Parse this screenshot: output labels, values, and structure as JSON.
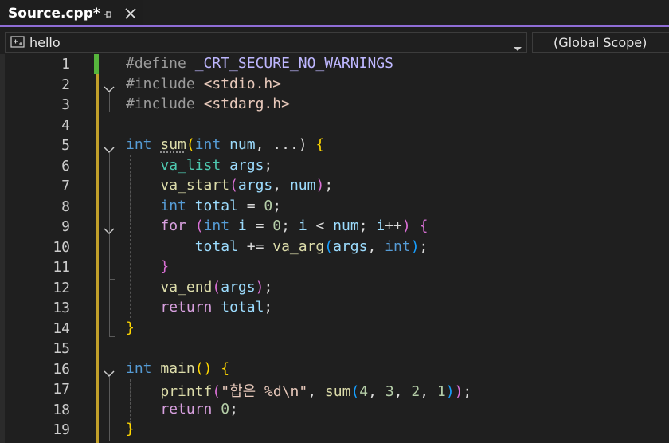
{
  "tab": {
    "title": "Source.cpp*",
    "pin_icon": "pin-icon",
    "close_icon": "close-icon"
  },
  "nav": {
    "left_scope": "hello",
    "right_scope": "(Global Scope)",
    "left_icon": "project-icon",
    "arrow_icon": "dropdown-arrow-icon"
  },
  "colors": {
    "accent": "#8f6dd6",
    "modified": "#56b53c",
    "saved": "#c2a02a",
    "background": "#1f1f1f"
  },
  "lines": [
    {
      "n": "1",
      "fold": false,
      "tokens": [
        [
          "pp",
          "#define"
        ],
        [
          "cm",
          " "
        ],
        [
          "macro",
          "_CRT_SECURE_NO_WARNINGS"
        ]
      ]
    },
    {
      "n": "2",
      "fold": true,
      "tokens": [
        [
          "pp",
          "#include"
        ],
        [
          "cm",
          " "
        ],
        [
          "str",
          "<stdio.h>"
        ]
      ]
    },
    {
      "n": "3",
      "fold": false,
      "tokens": [
        [
          "pp",
          "#include"
        ],
        [
          "cm",
          " "
        ],
        [
          "str",
          "<stdarg.h>"
        ]
      ]
    },
    {
      "n": "4",
      "fold": false,
      "tokens": []
    },
    {
      "n": "5",
      "fold": true,
      "tokens": [
        [
          "kw",
          "int"
        ],
        [
          "cm",
          " "
        ],
        [
          "fnsum",
          "sum"
        ],
        [
          "p1",
          "("
        ],
        [
          "kw",
          "int"
        ],
        [
          "cm",
          " "
        ],
        [
          "var",
          "num"
        ],
        [
          "cm",
          ", ...) "
        ],
        [
          "p1",
          "{"
        ]
      ]
    },
    {
      "n": "6",
      "fold": false,
      "tokens": [
        [
          "cm",
          "    "
        ],
        [
          "ty",
          "va_list"
        ],
        [
          "cm",
          " "
        ],
        [
          "var",
          "args"
        ],
        [
          "cm",
          ";"
        ]
      ]
    },
    {
      "n": "7",
      "fold": false,
      "tokens": [
        [
          "cm",
          "    "
        ],
        [
          "fn",
          "va_start"
        ],
        [
          "p2",
          "("
        ],
        [
          "var",
          "args"
        ],
        [
          "cm",
          ", "
        ],
        [
          "var",
          "num"
        ],
        [
          "p2",
          ")"
        ],
        [
          "cm",
          ";"
        ]
      ]
    },
    {
      "n": "8",
      "fold": false,
      "tokens": [
        [
          "cm",
          "    "
        ],
        [
          "kw",
          "int"
        ],
        [
          "cm",
          " "
        ],
        [
          "var",
          "total"
        ],
        [
          "cm",
          " = "
        ],
        [
          "num",
          "0"
        ],
        [
          "cm",
          ";"
        ]
      ]
    },
    {
      "n": "9",
      "fold": true,
      "tokens": [
        [
          "cm",
          "    "
        ],
        [
          "ctl",
          "for"
        ],
        [
          "cm",
          " "
        ],
        [
          "p2",
          "("
        ],
        [
          "kw",
          "int"
        ],
        [
          "cm",
          " "
        ],
        [
          "var",
          "i"
        ],
        [
          "cm",
          " = "
        ],
        [
          "num",
          "0"
        ],
        [
          "cm",
          "; "
        ],
        [
          "var",
          "i"
        ],
        [
          "cm",
          " < "
        ],
        [
          "var",
          "num"
        ],
        [
          "cm",
          "; "
        ],
        [
          "var",
          "i"
        ],
        [
          "cm",
          "++"
        ],
        [
          "p2",
          ")"
        ],
        [
          "cm",
          " "
        ],
        [
          "p2",
          "{"
        ]
      ]
    },
    {
      "n": "10",
      "fold": false,
      "tokens": [
        [
          "cm",
          "        "
        ],
        [
          "var",
          "total"
        ],
        [
          "cm",
          " += "
        ],
        [
          "fn",
          "va_arg"
        ],
        [
          "p3",
          "("
        ],
        [
          "var",
          "args"
        ],
        [
          "cm",
          ", "
        ],
        [
          "kw",
          "int"
        ],
        [
          "p3",
          ")"
        ],
        [
          "cm",
          ";"
        ]
      ]
    },
    {
      "n": "11",
      "fold": false,
      "tokens": [
        [
          "cm",
          "    "
        ],
        [
          "p2",
          "}"
        ]
      ]
    },
    {
      "n": "12",
      "fold": false,
      "tokens": [
        [
          "cm",
          "    "
        ],
        [
          "fn",
          "va_end"
        ],
        [
          "p2",
          "("
        ],
        [
          "var",
          "args"
        ],
        [
          "p2",
          ")"
        ],
        [
          "cm",
          ";"
        ]
      ]
    },
    {
      "n": "13",
      "fold": false,
      "tokens": [
        [
          "cm",
          "    "
        ],
        [
          "ctl",
          "return"
        ],
        [
          "cm",
          " "
        ],
        [
          "var",
          "total"
        ],
        [
          "cm",
          ";"
        ]
      ]
    },
    {
      "n": "14",
      "fold": false,
      "tokens": [
        [
          "p1",
          "}"
        ]
      ]
    },
    {
      "n": "15",
      "fold": false,
      "tokens": []
    },
    {
      "n": "16",
      "fold": true,
      "tokens": [
        [
          "kw",
          "int"
        ],
        [
          "cm",
          " "
        ],
        [
          "fn",
          "main"
        ],
        [
          "p1",
          "()"
        ],
        [
          "cm",
          " "
        ],
        [
          "p1",
          "{"
        ]
      ]
    },
    {
      "n": "17",
      "fold": false,
      "tokens": [
        [
          "cm",
          "    "
        ],
        [
          "fn",
          "printf"
        ],
        [
          "p2",
          "("
        ],
        [
          "str",
          "\"합은 "
        ],
        [
          "esc",
          "%d\\n"
        ],
        [
          "str",
          "\""
        ],
        [
          "cm",
          ", "
        ],
        [
          "fn",
          "sum"
        ],
        [
          "p3",
          "("
        ],
        [
          "num",
          "4"
        ],
        [
          "cm",
          ", "
        ],
        [
          "num",
          "3"
        ],
        [
          "cm",
          ", "
        ],
        [
          "num",
          "2"
        ],
        [
          "cm",
          ", "
        ],
        [
          "num",
          "1"
        ],
        [
          "p3",
          ")"
        ],
        [
          "p2",
          ")"
        ],
        [
          "cm",
          ";"
        ]
      ]
    },
    {
      "n": "18",
      "fold": false,
      "tokens": [
        [
          "cm",
          "    "
        ],
        [
          "ctl",
          "return"
        ],
        [
          "cm",
          " "
        ],
        [
          "num",
          "0"
        ],
        [
          "cm",
          ";"
        ]
      ]
    },
    {
      "n": "19",
      "fold": false,
      "tokens": [
        [
          "p1",
          "}"
        ]
      ]
    }
  ]
}
